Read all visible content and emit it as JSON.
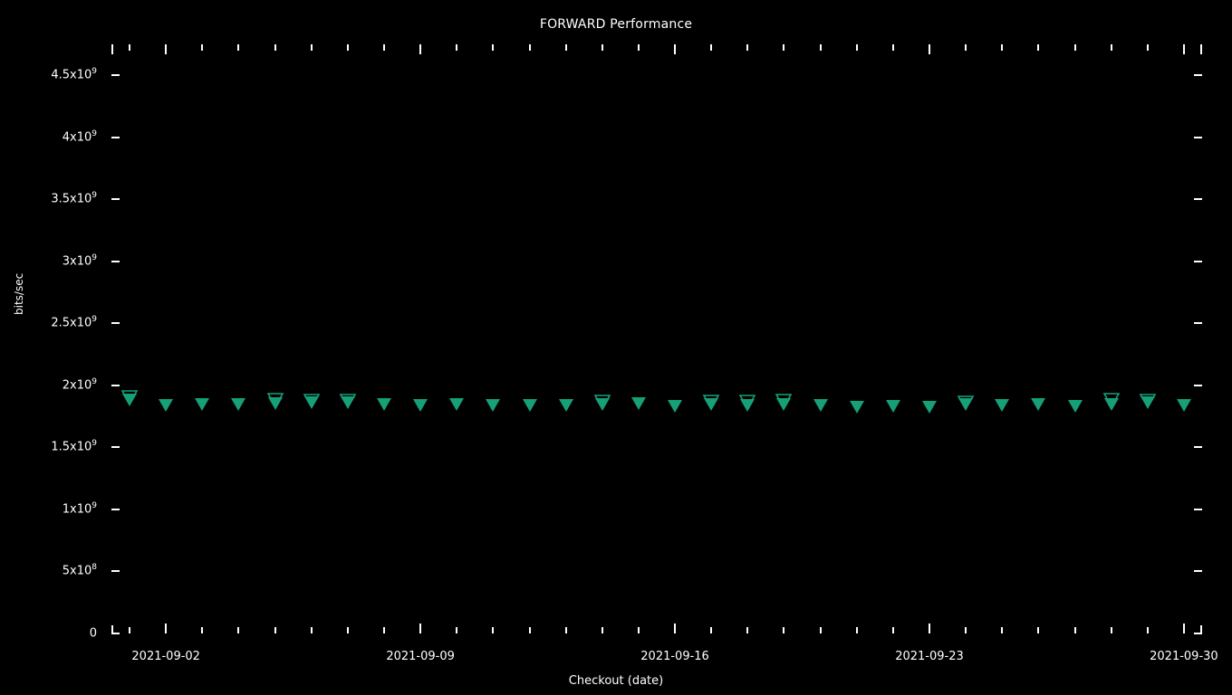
{
  "chart_data": {
    "type": "scatter",
    "title": "FORWARD Performance",
    "xlabel": "Checkout (date)",
    "ylabel": "bits/sec",
    "grid": false,
    "legend": false,
    "background_color": "#000000",
    "foreground_color": "#ffffff",
    "marker_color": "#16A077",
    "marker_shape": "triangle-down",
    "xlim": [
      "2021-09-01",
      "2021-09-30"
    ],
    "ylim": [
      0,
      4750000000
    ],
    "yticks": [
      {
        "value": 4500000000,
        "label": "4.5x10",
        "exponent": "9"
      },
      {
        "value": 4000000000,
        "label": "4x10",
        "exponent": "9"
      },
      {
        "value": 3500000000,
        "label": "3.5x10",
        "exponent": "9"
      },
      {
        "value": 3000000000,
        "label": "3x10",
        "exponent": "9"
      },
      {
        "value": 2500000000,
        "label": "2.5x10",
        "exponent": "9"
      },
      {
        "value": 2000000000,
        "label": "2x10",
        "exponent": "9"
      },
      {
        "value": 1500000000,
        "label": "1.5x10",
        "exponent": "9"
      },
      {
        "value": 1000000000,
        "label": "1x10",
        "exponent": "9"
      },
      {
        "value": 500000000,
        "label": "5x10",
        "exponent": "8"
      },
      {
        "value": 0,
        "label": "0",
        "exponent": ""
      }
    ],
    "xticks": [
      {
        "index": 1,
        "label": "2021-09-02",
        "major": true
      },
      {
        "index": 8,
        "label": "2021-09-09",
        "major": true
      },
      {
        "index": 15,
        "label": "2021-09-16",
        "major": true
      },
      {
        "index": 22,
        "label": "2021-09-23",
        "major": true
      },
      {
        "index": 29,
        "label": "2021-09-30",
        "major": true
      }
    ],
    "x": [
      "2021-09-01",
      "2021-09-02",
      "2021-09-03",
      "2021-09-04",
      "2021-09-05",
      "2021-09-06",
      "2021-09-07",
      "2021-09-08",
      "2021-09-09",
      "2021-09-10",
      "2021-09-11",
      "2021-09-12",
      "2021-09-13",
      "2021-09-14",
      "2021-09-15",
      "2021-09-16",
      "2021-09-17",
      "2021-09-18",
      "2021-09-19",
      "2021-09-20",
      "2021-09-21",
      "2021-09-22",
      "2021-09-23",
      "2021-09-24",
      "2021-09-25",
      "2021-09-26",
      "2021-09-27",
      "2021-09-28",
      "2021-09-29",
      "2021-09-30"
    ],
    "series": [
      {
        "name": "FORWARD",
        "marker": "triangle-down",
        "color": "#16A077",
        "values": [
          1880000000,
          1838000000,
          1843000000,
          1848000000,
          1851000000,
          1861000000,
          1858000000,
          1849000000,
          1840000000,
          1845000000,
          1842000000,
          1841000000,
          1836000000,
          1845000000,
          1851000000,
          1829000000,
          1846000000,
          1842000000,
          1848000000,
          1836000000,
          1826000000,
          1834000000,
          1826000000,
          1845000000,
          1841000000,
          1849000000,
          1832000000,
          1845000000,
          1860000000,
          1840000000
        ],
        "secondary_values": [
          1907000000,
          null,
          null,
          null,
          1880000000,
          1878000000,
          1876000000,
          null,
          null,
          null,
          null,
          null,
          null,
          1868000000,
          null,
          null,
          1866000000,
          1866000000,
          1872000000,
          null,
          null,
          null,
          null,
          1863000000,
          null,
          null,
          null,
          1886000000,
          1876000000,
          null
        ]
      }
    ]
  }
}
